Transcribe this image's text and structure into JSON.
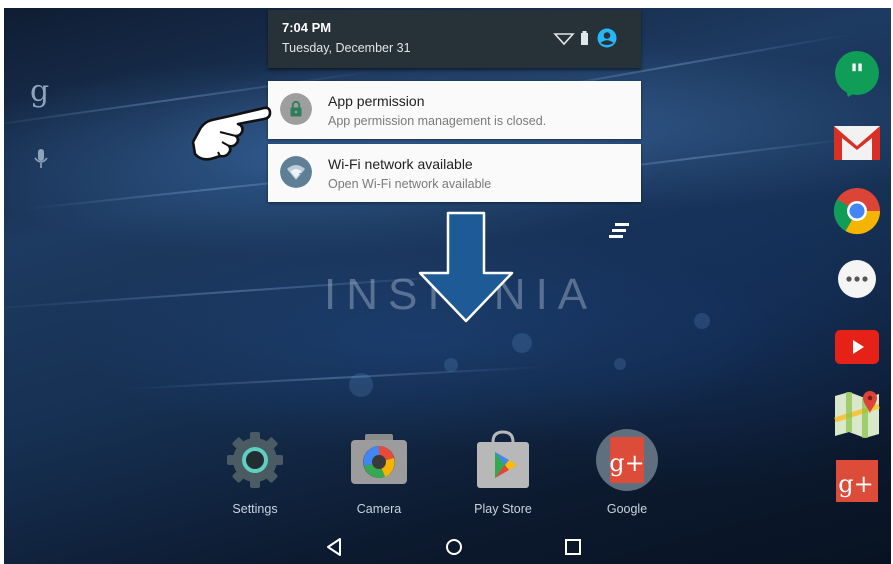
{
  "status_bar": {
    "time": "7:04 PM",
    "date": "Tuesday, December 31"
  },
  "notifications": [
    {
      "title": "App permission",
      "text": "App permission management is closed.",
      "icon": "lock-icon",
      "icon_color": "#9e9e9e"
    },
    {
      "title": "Wi-Fi network available",
      "text": "Open Wi-Fi network available",
      "icon": "wifi-icon",
      "icon_color": "#5e7f95"
    }
  ],
  "wallpaper": {
    "brand_text": "INSIGNIA"
  },
  "home": {
    "left_icons": [
      "google-search-icon",
      "microphone-icon"
    ],
    "dock_right": [
      "hangouts-icon",
      "gmail-icon",
      "chrome-icon",
      "app-drawer-icon",
      "youtube-icon",
      "maps-icon",
      "google-plus-icon"
    ],
    "bottom_apps": [
      {
        "label": "Settings",
        "icon": "settings-icon"
      },
      {
        "label": "Camera",
        "icon": "camera-icon"
      },
      {
        "label": "Play Store",
        "icon": "play-store-icon"
      },
      {
        "label": "Google",
        "icon": "google-folder-icon"
      }
    ]
  },
  "navigation": [
    "back-icon",
    "home-icon",
    "recents-icon"
  ],
  "annotations": [
    "pointing-hand-icon",
    "swipe-down-arrow-icon"
  ],
  "colors": {
    "shade_header": "#263238",
    "accent_avatar": "#29b6f6",
    "notification_bg": "#fafafa"
  }
}
